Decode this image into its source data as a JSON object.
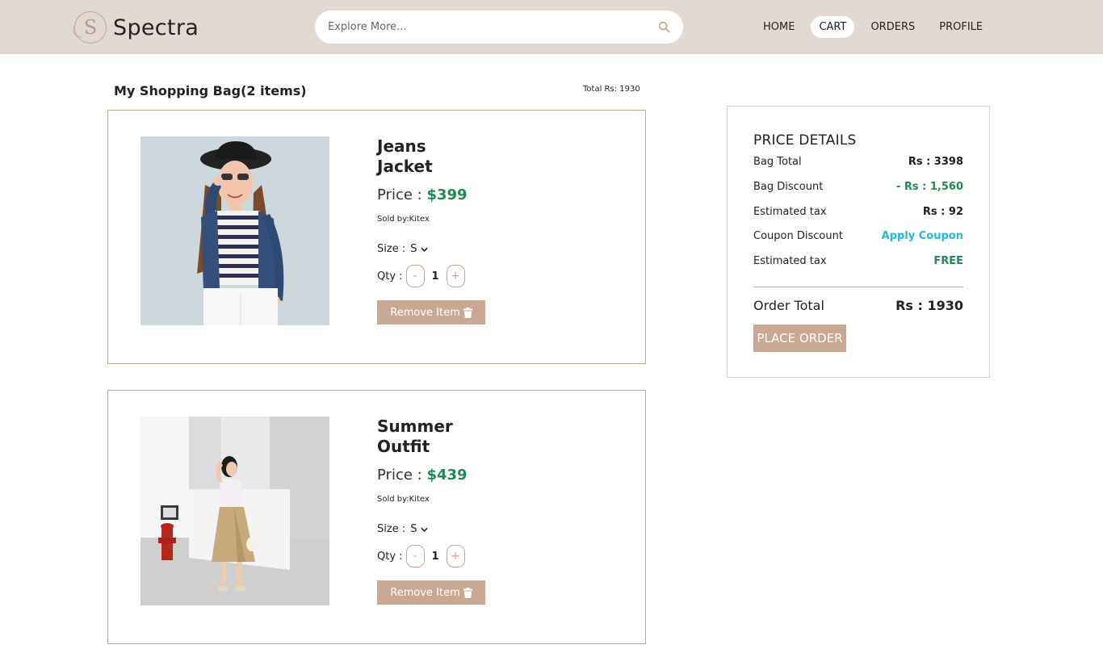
{
  "header": {
    "logo_text": "Spectra",
    "logo_mark": "S",
    "search_placeholder": "Explore More...",
    "nav": [
      "HOME",
      "CART",
      "ORDERS",
      "PROFILE"
    ],
    "active_nav": "CART"
  },
  "bag": {
    "title": "My Shopping Bag(2 items)",
    "total": "Total Rs: 1930"
  },
  "items": [
    {
      "name_line1": "Jeans",
      "name_line2": "Jacket",
      "price_label": "Price :",
      "price": "$399",
      "seller": "Sold by:Kitex",
      "size_label": "Size :",
      "size": "S",
      "qty_label": "Qty :",
      "qty": "1",
      "minus": "-",
      "plus": "+",
      "remove_label": "Remove Item"
    },
    {
      "name_line1": "Summer",
      "name_line2": "Outfit",
      "price_label": "Price :",
      "price": "$439",
      "seller": "Sold by:Kitex",
      "size_label": "Size :",
      "size": "S",
      "qty_label": "Qty :",
      "qty": "1",
      "minus": "-",
      "plus": "+",
      "remove_label": "Remove Item"
    }
  ],
  "price_details": {
    "title": "PRICE DETAILS",
    "rows": [
      {
        "label": "Bag Total",
        "value": "Rs : 3398"
      },
      {
        "label": "Bag Discount",
        "value": "- Rs : 1,560"
      },
      {
        "label": "Estimated tax",
        "value": "Rs : 92"
      },
      {
        "label": "Coupon Discount",
        "value": "Apply Coupon"
      },
      {
        "label": "Estimated tax",
        "value": "FREE"
      }
    ],
    "total_label": "Order Total",
    "total_value": "Rs : 1930",
    "place_order": "PLACE ORDER"
  },
  "colors": {
    "nav_bg": "#e2d9d3",
    "accent": "#c9a893",
    "green": "#1d8a56",
    "cyan": "#1fb9e0"
  }
}
